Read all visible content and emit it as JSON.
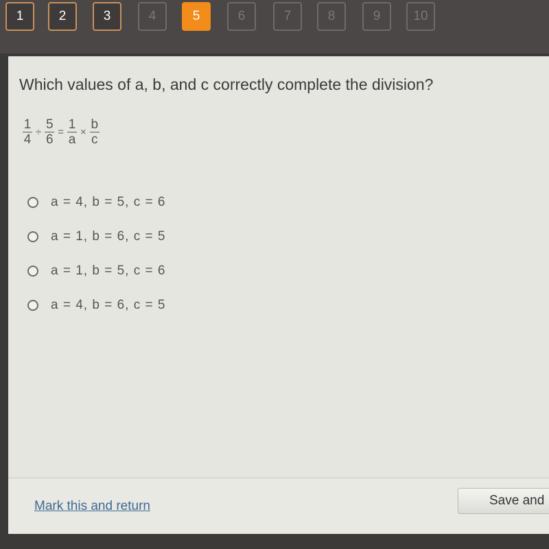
{
  "nav": {
    "questions": [
      {
        "label": "1",
        "state": "visited"
      },
      {
        "label": "2",
        "state": "visited"
      },
      {
        "label": "3",
        "state": "visited"
      },
      {
        "label": "4",
        "state": "unvisited"
      },
      {
        "label": "5",
        "state": "current"
      },
      {
        "label": "6",
        "state": "unvisited"
      },
      {
        "label": "7",
        "state": "unvisited"
      },
      {
        "label": "8",
        "state": "unvisited"
      },
      {
        "label": "9",
        "state": "unvisited"
      },
      {
        "label": "10",
        "state": "unvisited"
      }
    ],
    "accent_color": "#f28c1a"
  },
  "question": {
    "text": "Which values of a, b, and c correctly complete the division?",
    "equation": {
      "f1": {
        "num": "1",
        "den": "4"
      },
      "op1": "÷",
      "f2": {
        "num": "5",
        "den": "6"
      },
      "eq": "=",
      "f3": {
        "num": "1",
        "den": "a"
      },
      "op2": "×",
      "f4": {
        "num": "b",
        "den": "c"
      }
    }
  },
  "options": [
    {
      "label": "a = 4, b = 5, c = 6"
    },
    {
      "label": "a = 1, b = 6, c = 5"
    },
    {
      "label": "a = 1, b = 5, c = 6"
    },
    {
      "label": "a = 4, b = 6, c = 5"
    }
  ],
  "footer": {
    "mark_link": "Mark this and return",
    "save_button": "Save and"
  }
}
